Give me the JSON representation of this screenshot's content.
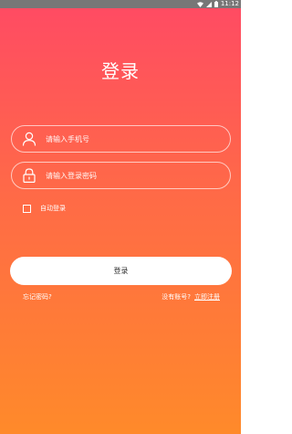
{
  "status_bar": {
    "time": "11:12",
    "icons": [
      "wifi-icon",
      "signal-icon",
      "battery-icon"
    ]
  },
  "login": {
    "title": "登录",
    "phone_placeholder": "请输入手机号",
    "password_placeholder": "请输入登录密码",
    "remember_label": "自动登录",
    "remember_checked": false,
    "submit_label": "登录",
    "forgot_label": "忘记密码?",
    "no_account_label": "没有账号?",
    "register_label": "立即注册",
    "icons": {
      "phone_field": "user-icon",
      "password_field": "lock-icon"
    }
  },
  "colors": {
    "gradient_top": "#ff4a64",
    "gradient_bottom": "#ff8a2a",
    "status_bar": "#777777",
    "button_bg": "#ffffff",
    "button_text": "#333333"
  }
}
